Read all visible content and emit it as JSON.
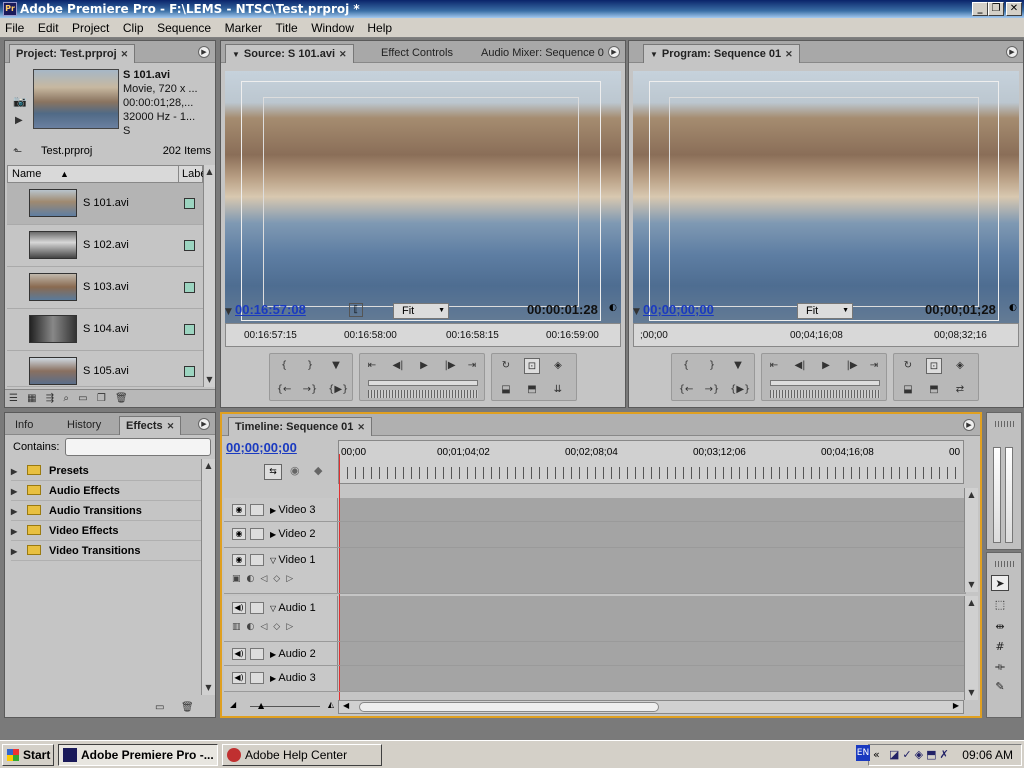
{
  "window": {
    "title": "Adobe Premiere Pro - F:\\LEMS - NTSC\\Test.prproj *"
  },
  "menu": [
    "File",
    "Edit",
    "Project",
    "Clip",
    "Sequence",
    "Marker",
    "Title",
    "Window",
    "Help"
  ],
  "project": {
    "tab": "Project: Test.prproj",
    "clip_name": "S 101.avi",
    "clip_info": [
      "Movie, 720 x ...",
      "00:00:01;28,...",
      "32000 Hz - 1...",
      "S"
    ],
    "project_file": "Test.prproj",
    "item_count": "202 Items",
    "col_name": "Name",
    "col_label": "Labe",
    "items": [
      {
        "name": "S 101.avi"
      },
      {
        "name": "S 102.avi"
      },
      {
        "name": "S 103.avi"
      },
      {
        "name": "S 104.avi"
      },
      {
        "name": "S 105.avi"
      }
    ]
  },
  "effects": {
    "tabs": [
      "Info",
      "History",
      "Effects"
    ],
    "contains_label": "Contains:",
    "items": [
      "Presets",
      "Audio Effects",
      "Audio Transitions",
      "Video Effects",
      "Video Transitions"
    ]
  },
  "source": {
    "tabs": [
      "Source: S 101.avi",
      "Effect Controls",
      "Audio Mixer: Sequence 0"
    ],
    "current_time": "00:16:57:08",
    "duration": "00:00:01:28",
    "zoom": "Fit",
    "ruler": [
      "00:16:57:15",
      "00:16:58:00",
      "00:16:58:15",
      "00:16:59:00"
    ]
  },
  "program": {
    "tab": "Program: Sequence 01",
    "current_time": "00;00;00;00",
    "duration": "00;00;01;28",
    "zoom": "Fit",
    "ruler": [
      ";00;00",
      "00;04;16;08",
      "00;08;32;16"
    ]
  },
  "timeline": {
    "tab": "Timeline: Sequence 01",
    "current_time": "00;00;00;00",
    "ruler": [
      "00;00",
      "00;01;04;02",
      "00;02;08;04",
      "00;03;12;06",
      "00;04;16;08",
      "00"
    ],
    "tracks": [
      "Video 3",
      "Video 2",
      "Video 1",
      "Audio 1",
      "Audio 2",
      "Audio 3"
    ]
  },
  "taskbar": {
    "start": "Start",
    "buttons": [
      "Adobe Premiere Pro -...",
      "Adobe Help Center"
    ],
    "lang": "EN",
    "clock": "09:06 AM"
  }
}
